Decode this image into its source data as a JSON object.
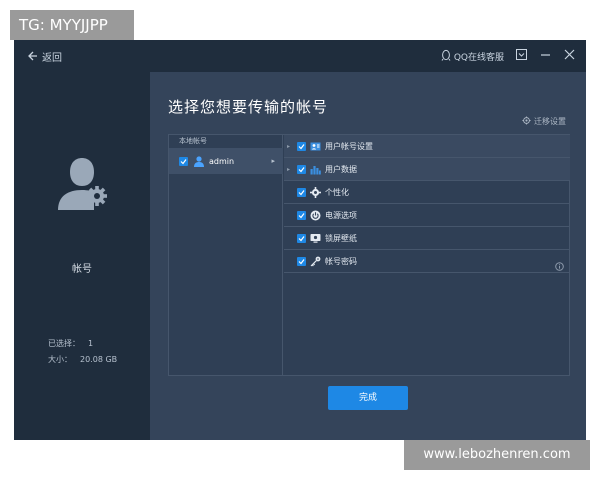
{
  "watermark": {
    "top": "TG: MYYJJPP",
    "bottom": "www.lebozhenren.com"
  },
  "titlebar": {
    "back_label": "返回",
    "qq_label": "QQ在线客服",
    "icons": [
      "back-arrow-icon",
      "qq-penguin-icon",
      "dropdown-menu-icon",
      "minimize-icon",
      "close-icon"
    ]
  },
  "left": {
    "account_label": "帐号",
    "selected_label": "已选择：",
    "selected_value": "1",
    "size_label": "大小：",
    "size_value": "20.08 GB"
  },
  "main": {
    "heading": "选择您想要传输的帐号",
    "migrate_label": "迁移设置",
    "local_accounts_header": "本地帐号",
    "account": {
      "name": "admin",
      "checked": true
    },
    "items": [
      {
        "label": "用户帐号设置",
        "icon": "user-account-settings-icon",
        "checked": true,
        "expandable": true
      },
      {
        "label": "用户数据",
        "icon": "user-data-icon",
        "checked": true,
        "expandable": true
      },
      {
        "label": "个性化",
        "icon": "personalization-gear-icon",
        "checked": true,
        "expandable": false
      },
      {
        "label": "电源选项",
        "icon": "power-icon",
        "checked": true,
        "expandable": false
      },
      {
        "label": "锁屏壁纸",
        "icon": "monitor-wallpaper-icon",
        "checked": true,
        "expandable": false
      },
      {
        "label": "帐号密码",
        "icon": "key-icon",
        "checked": true,
        "expandable": false
      }
    ],
    "done_label": "完成"
  },
  "colors": {
    "accent": "#1e88e5",
    "titlebar": "#1f2d3d",
    "panel": "#34445a",
    "text": "#e4eaf1"
  }
}
